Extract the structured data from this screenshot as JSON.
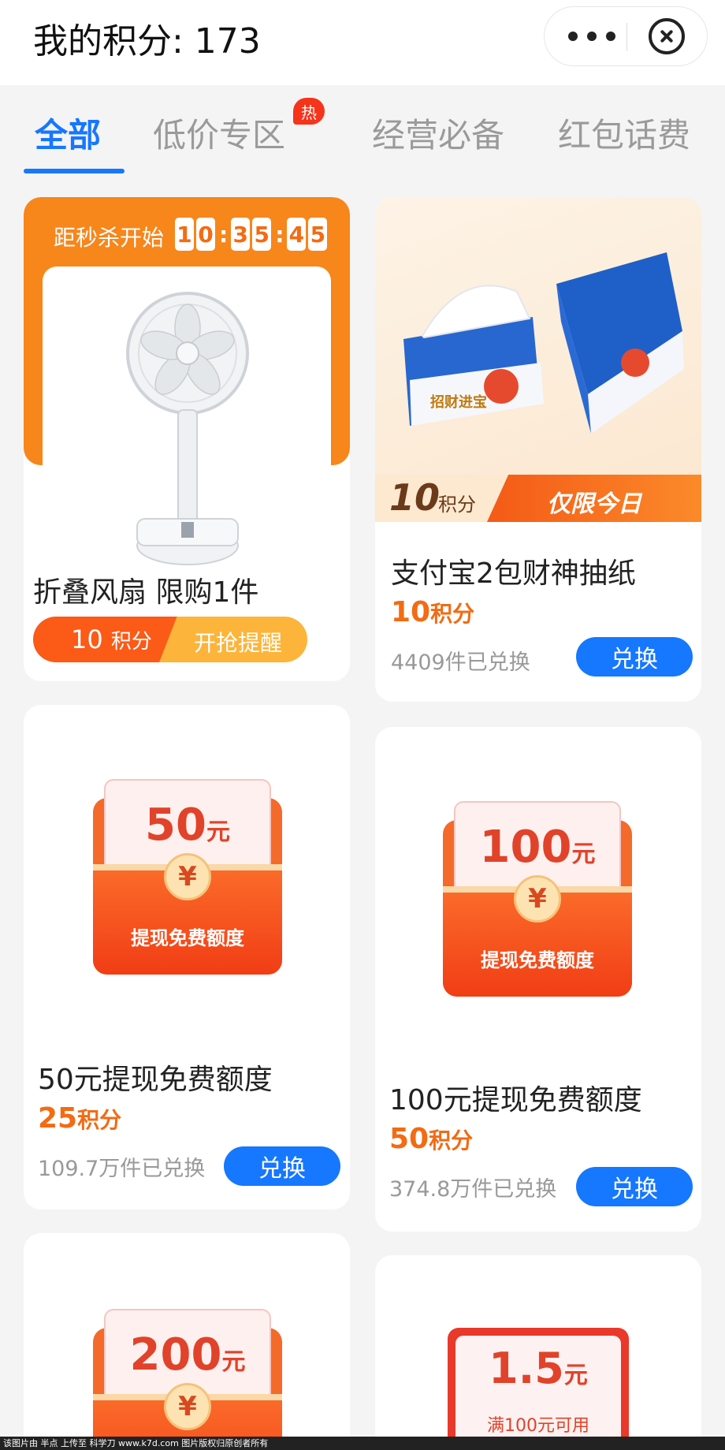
{
  "header": {
    "title": "我的积分: 173",
    "more_icon": "more-dots-icon",
    "close_icon": "close-circle-icon"
  },
  "tabs": [
    {
      "label": "全部",
      "active": true
    },
    {
      "label": "低价专区",
      "badge": "热"
    },
    {
      "label": "经营必备"
    },
    {
      "label": "红包话费"
    }
  ],
  "products": {
    "fan": {
      "flash_label": "距秒杀开始",
      "countdown": [
        "1",
        "0",
        "3",
        "5",
        "4",
        "5"
      ],
      "name": "折叠风扇 限购1件",
      "points_num": "10",
      "points_unit": "积分",
      "remind_label": "开抢提醒"
    },
    "tissue": {
      "strip_num": "10",
      "strip_unit": "积分",
      "strip_tag": "仅限今日",
      "name": "支付宝2包财神抽纸",
      "points_num": "10",
      "points_unit": "积分",
      "redeemed": "4409件已兑换",
      "button": "兑换"
    },
    "env50": {
      "amount": "50",
      "unit": "元",
      "caption": "提现免费额度",
      "name": "50元提现免费额度",
      "points_num": "25",
      "points_unit": "积分",
      "redeemed": "109.7万件已兑换",
      "button": "兑换"
    },
    "env100": {
      "amount": "100",
      "unit": "元",
      "caption": "提现免费额度",
      "name": "100元提现免费额度",
      "points_num": "50",
      "points_unit": "积分",
      "redeemed": "374.8万件已兑换",
      "button": "兑换"
    },
    "env200": {
      "amount": "200",
      "unit": "元"
    },
    "coupon": {
      "amount": "1.5",
      "unit": "元",
      "condition": "满100元可用"
    }
  },
  "footer": "该图片由 半点 上传至 科学刀 www.k7d.com 图片版权归原创者所有",
  "colors": {
    "accent": "#1677ff",
    "points": "#f36b13",
    "flash": "#f7861b"
  }
}
